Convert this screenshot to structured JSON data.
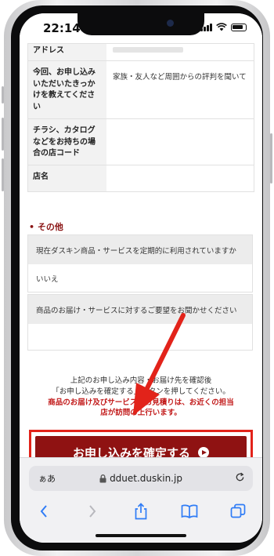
{
  "status_bar": {
    "time": "22:14"
  },
  "form_table": {
    "rows": [
      {
        "label": "アドレス",
        "value": ""
      },
      {
        "label": "今回、お申し込みいただいたきっかけを教えてください",
        "value": "家族・友人など周囲からの評判を聞いて"
      },
      {
        "label": "チラシ、カタログなどをお持ちの場合の店コード",
        "value": ""
      },
      {
        "label": "店名",
        "value": ""
      }
    ]
  },
  "other_section": {
    "title": "• その他",
    "q1": "現在ダスキン商品・サービスを定期的に利用されていますか",
    "a1": "いいえ",
    "q2": "商品のお届け・サービスに対するご要望をお聞かせください",
    "a2": ""
  },
  "confirm_note": {
    "line1": "上記のお申し込み内容・お届け先を確認後",
    "line2": "「お申し込みを確定する」ボタンを押してください。",
    "red1": "商品のお届け及びサービスのお見積りは、お近くの担当",
    "red2": "店が訪問の上行います。"
  },
  "cta": {
    "label": "お申し込みを確定する"
  },
  "browser": {
    "aa": "ぁあ",
    "url": "dduet.duskin.jp"
  },
  "colors": {
    "accent": "#8f1212",
    "highlight": "#e2231a"
  }
}
